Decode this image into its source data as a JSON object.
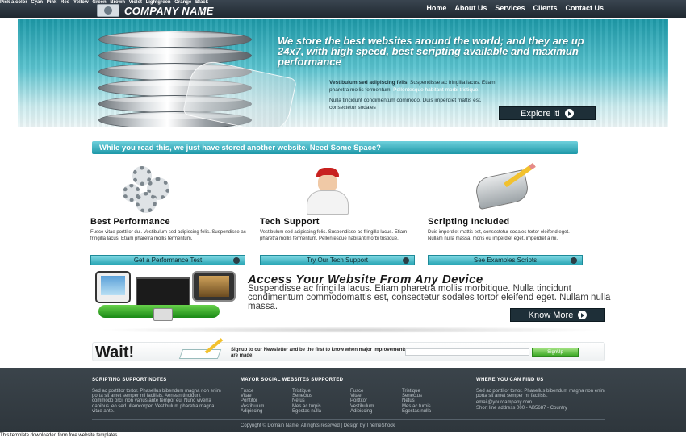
{
  "colorpicker": {
    "label": "Pick a color",
    "colors": [
      "Cyan",
      "Pink",
      "Red",
      "Yellow",
      "Green",
      "Brown",
      "Violet",
      "Lightgreen",
      "Orange",
      "Black"
    ]
  },
  "logo": {
    "text": "COMPANY NAME"
  },
  "nav": {
    "items": [
      "Home",
      "About Us",
      "Services",
      "Clients",
      "Contact Us"
    ]
  },
  "hero": {
    "title": "We store the best websites around the world; and they are up 24x7, with high speed, best scripting available and maximun performance",
    "body_bold": "Vestibulum sed adipiscing felis.",
    "body_1a": " Suspendisse ac fringilla lacus. Etiam pharetra mollis fermentum. ",
    "body_white": "Pellentesque habitant morbi tristique.",
    "body_2": "Nulla tincidunt condimentum commodo. Duis imperdiet mattis est, consectetur sodales",
    "explore_label": "Explore it!"
  },
  "ribbon": {
    "text": "While you read this, we just have stored another website. Need Some Space?"
  },
  "features": [
    {
      "title": "Best Performance",
      "text": "Fusce vitae porttitor dui. Vestibulum sed adipiscing felis. Suspendisse ac fringilla lacus. Etiam pharetra mollis fermentum.",
      "button": "Get a Performance Test"
    },
    {
      "title": "Tech Support",
      "text": "Vestibulum sed adipiscing felis. Suspendisse ac fringilla lacus. Etiam pharetra mollis fermentum. Pellentesque habitant morbi tristique.",
      "button": "Try Our Tech Support"
    },
    {
      "title": "Scripting Included",
      "text": "Duis imperdiet mattis est, consectetur sodales tortor eleifend eget. Nullam nulla massa, mons eu imperdiet eget, imperdiet a mi.",
      "button": "See Examples Scripts"
    }
  ],
  "access": {
    "title": "Access Your Website From Any Device",
    "body": "Suspendisse ac fringilla lacus. Etiam pharetra mollis morbitique. Nulla tincidunt condimentum commodomattis est, consectetur sodales tortor eleifend eget. Nullam nulla massa.",
    "button": "Know More"
  },
  "newsletter": {
    "wait": "Wait!",
    "text": "Signup to our Newsletter and be the first to know when major improvements are made!",
    "input_value": "",
    "button": "SignUp"
  },
  "footer": {
    "col1": {
      "heading": "SCRIPTING SUPPORT NOTES",
      "text": "Sed ac porttitor tortor. Phasellus bibendum magna non enim porta sit amet semper mi facilisis. Aenean tincidunt commodo orci, non varius ante tempor eu. Nunc viverra dapibus leo sed ullamcorper. Vestibulum pharetra magna vitae ante."
    },
    "col2": {
      "heading": "MAYOR SOCIAL WEBSITES SUPPORTED",
      "lists": [
        [
          "Fusce",
          "Vitae",
          "Porttitor",
          "Vestibulum",
          "Adipiscing"
        ],
        [
          "Tristique",
          "Senectus",
          "Netus",
          "Mes ac turpis",
          "Egestas nulla"
        ],
        [
          "Fusce",
          "Vitae",
          "Porttitor",
          "Vestibulum",
          "Adipiscing"
        ],
        [
          "Tristique",
          "Senectus",
          "Netus",
          "Mes ac turpis",
          "Egestas nulla"
        ]
      ]
    },
    "col3": {
      "heading": "WHERE YOU CAN FIND US",
      "text": "Sed ac porttitor tortor. Phasellus bibendum magna non enim porta sit amet semper mi facilisis.",
      "email": "email@yourcampany.com",
      "address": "Short line address 000 - AB5687 - Country"
    },
    "copyright": "Copyright © Domain Name, All rights reserved | Design by ThemeShock"
  },
  "bottom": {
    "text": "This template downloaded form ",
    "link": "free website templates"
  }
}
